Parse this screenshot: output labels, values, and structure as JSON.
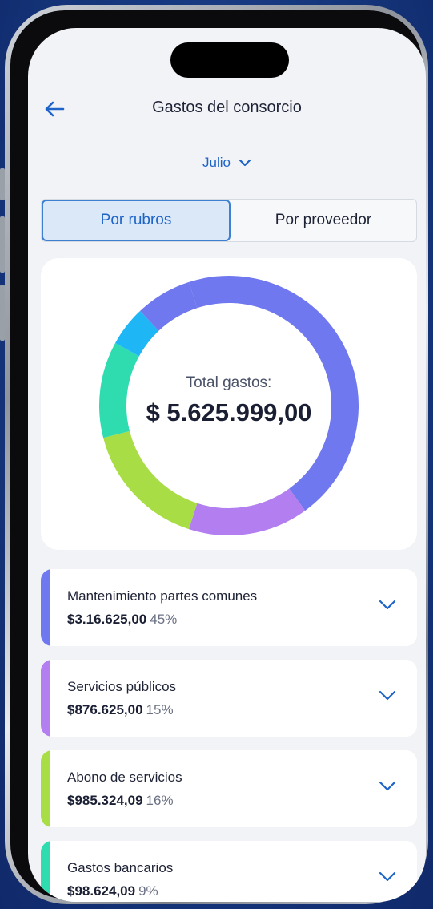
{
  "header": {
    "title": "Gastos del consorcio"
  },
  "filter": {
    "month": "Julio"
  },
  "tabs": [
    {
      "label": "Por rubros",
      "active": true
    },
    {
      "label": "Por proveedor",
      "active": false
    }
  ],
  "summary": {
    "total_label": "Total gastos:",
    "total_value": "$ 5.625.999,00"
  },
  "chart_data": {
    "type": "pie",
    "title": "",
    "series": [
      {
        "color": "#6f78ee",
        "value": 45
      },
      {
        "color": "#b27ef0",
        "value": 15
      },
      {
        "color": "#a8dd46",
        "value": 16
      },
      {
        "color": "#2fdcb0",
        "value": 12
      },
      {
        "color": "#1eb6f5",
        "value": 5
      },
      {
        "color": "#6f78ee",
        "value": 7
      }
    ]
  },
  "expenses": [
    {
      "name": "Mantenimiento partes comunes",
      "amount": "$3.16.625,00",
      "percent": "45%",
      "color": "#6f78ee"
    },
    {
      "name": "Servicios públicos",
      "amount": "$876.625,00",
      "percent": "15%",
      "color": "#b27ef0"
    },
    {
      "name": "Abono de servicios",
      "amount": "$985.324,09",
      "percent": "16%",
      "color": "#a8dd46"
    },
    {
      "name": "Gastos bancarios",
      "amount": "$98.624,09",
      "percent": "9%",
      "color": "#2fdcb0"
    }
  ],
  "icons": {
    "back": "arrow-left-icon",
    "dropdown": "chevron-down-icon",
    "expand": "chevron-down-icon"
  },
  "colors": {
    "accent": "#1e64c8",
    "background": "#f2f3f6"
  }
}
